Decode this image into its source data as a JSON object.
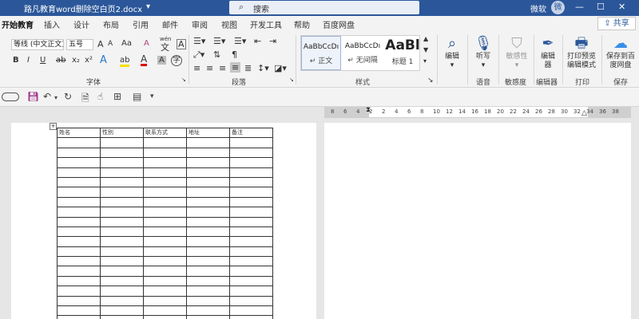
{
  "titlebar": {
    "doc_title": "路凡教育word删除空白页2.docx",
    "search_placeholder": "搜索",
    "user": "微软",
    "avatar_letter": "微",
    "min_icon": "minimize-icon",
    "max_icon": "maximize-icon",
    "close_icon": "close-icon"
  },
  "tabs": [
    "开始教育",
    "插入",
    "设计",
    "布局",
    "引用",
    "邮件",
    "审阅",
    "视图",
    "开发工具",
    "帮助",
    "百度网盘"
  ],
  "share_label": "共享",
  "ribbon": {
    "font": {
      "name": "等线 (中文正文)",
      "size": "五号",
      "grow": "A",
      "shrink": "A",
      "case": "Aa",
      "clear": "A",
      "wen": "wén",
      "bold": "B",
      "italic": "I",
      "underline": "U",
      "strike": "ab",
      "subscript": "x₂",
      "superscript": "x²",
      "effects": "A",
      "highlight": "ab",
      "color": "A",
      "shade": "A",
      "circle": "字",
      "label": "字体"
    },
    "paragraph": {
      "label": "段落"
    },
    "styles": {
      "items": [
        {
          "sample": "AaBbCcDı",
          "name": "↵ 正文"
        },
        {
          "sample": "AaBbCcDı",
          "name": "↵ 无间隔"
        },
        {
          "sample": "AaBl",
          "name": "标题 1"
        }
      ],
      "label": "样式"
    },
    "edit": {
      "label": "编辑",
      "group": ""
    },
    "voice": {
      "label": "听写",
      "group": "语音"
    },
    "sensitivity": {
      "label": "敏感性",
      "group": "敏感度"
    },
    "editor": {
      "label": "编辑器",
      "group": "编辑器"
    },
    "print": {
      "label": "打印预览编辑模式",
      "group": "打印"
    },
    "save": {
      "label": "保存到百度网盘",
      "group": "保存"
    }
  },
  "ruler_ticks": [
    "8",
    "6",
    "4",
    "2",
    "2",
    "4",
    "6",
    "8",
    "10",
    "12",
    "14",
    "16",
    "18",
    "20",
    "22",
    "24",
    "26",
    "28",
    "30",
    "32",
    "34",
    "36",
    "38"
  ],
  "table": {
    "headers": [
      "姓名",
      "性别",
      "联系方式",
      "地址",
      "备注"
    ],
    "row_count": 19
  }
}
